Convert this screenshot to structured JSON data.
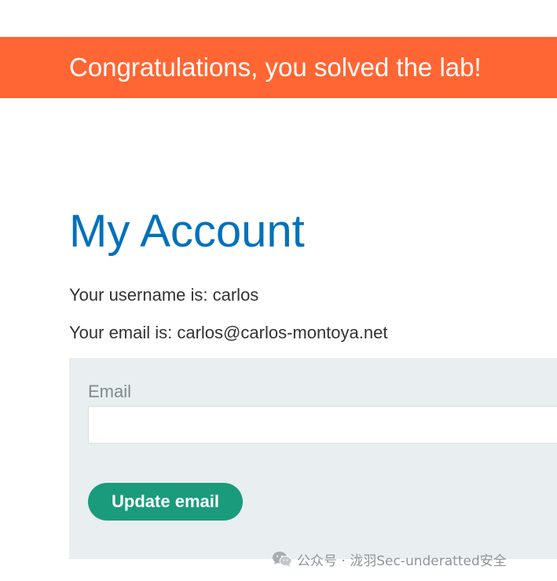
{
  "banner": {
    "message": "Congratulations, you solved the lab!",
    "color": "#ff6633"
  },
  "account": {
    "title": "My Account",
    "username_line": "Your username is: carlos",
    "email_line": "Your email is: carlos@carlos-montoya.net"
  },
  "form": {
    "email_label": "Email",
    "email_value": "",
    "submit_label": "Update email",
    "button_color": "#1a9b7c"
  },
  "watermark": {
    "icon": "wechat-icon",
    "text": "公众号 · 泷羽Sec-underatted安全"
  }
}
